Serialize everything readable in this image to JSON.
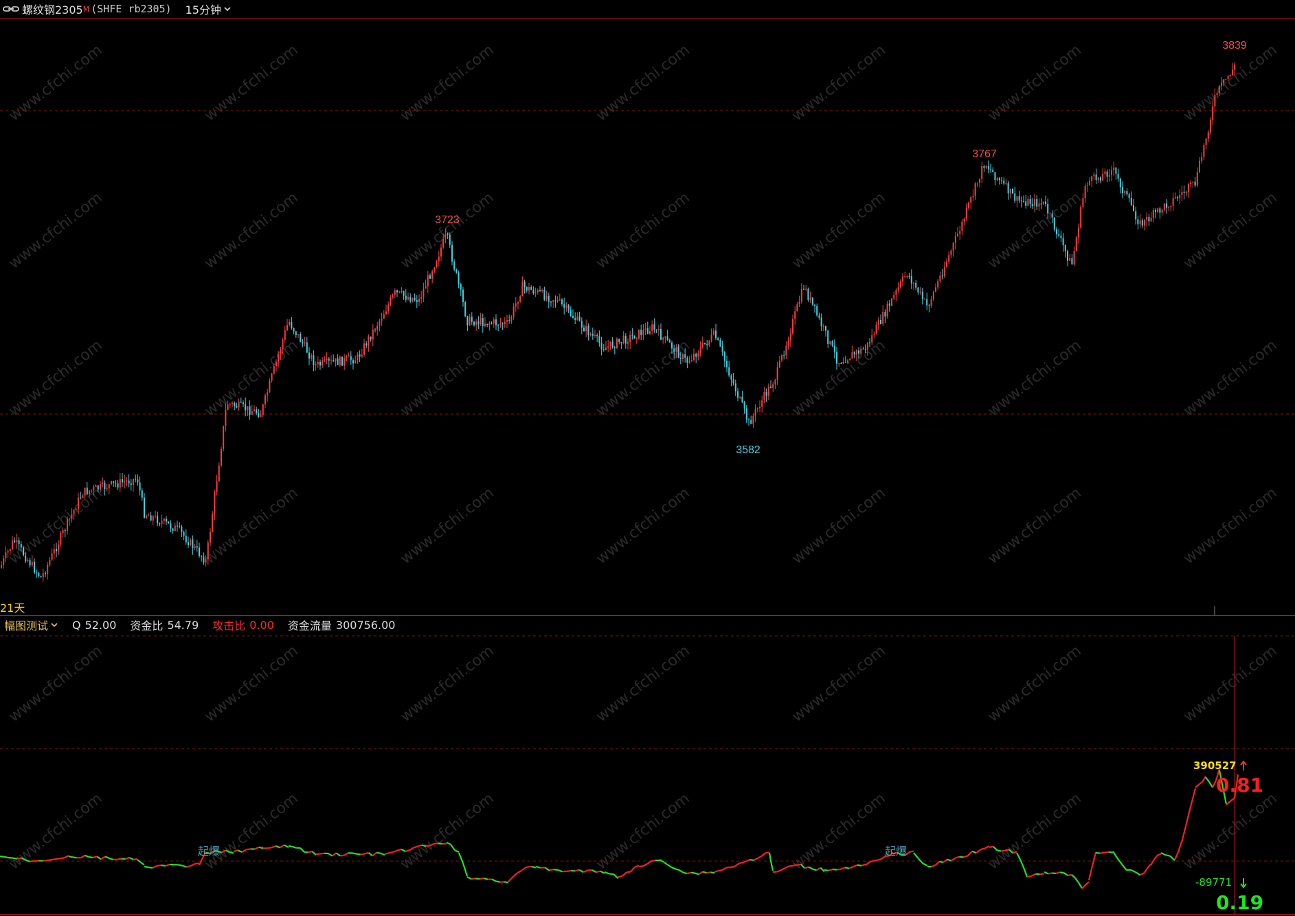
{
  "header": {
    "symbol_name": "螺纹钢2305",
    "marker": "M",
    "symbol_code": "(SHFE rb2305)",
    "period": "15分钟"
  },
  "main_chart": {
    "labels": {
      "high1": "3723",
      "high2": "3767",
      "high3": "3839",
      "low1": "3582"
    },
    "range_label": "21天",
    "colors": {
      "up": "#ff3b3b",
      "down": "#35d6e6",
      "grid": "#8a1010"
    }
  },
  "indicator": {
    "name": "幅图测试",
    "items": [
      {
        "label": "Q",
        "value": "52.00"
      },
      {
        "label": "资金比",
        "value": "54.79"
      },
      {
        "label": "攻击比",
        "value": "0.00"
      },
      {
        "label": "资金流量",
        "value": "300756.00"
      }
    ],
    "marks": {
      "upper_value": "390527",
      "lower_value": "-89771",
      "big_red": "0.81",
      "big_green": "0.19"
    },
    "annotations": [
      "起爆",
      "起爆"
    ],
    "colors": {
      "up": "#ff1e1e",
      "down": "#1ee61e",
      "text_yellow": "#ffe000"
    }
  },
  "watermark": "www.cfchi.com"
}
